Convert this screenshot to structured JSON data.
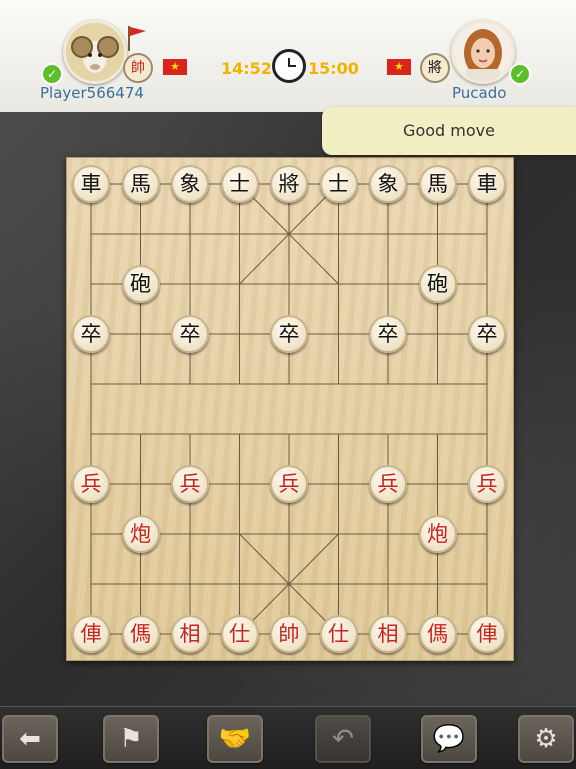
{
  "players": {
    "left": {
      "name": "Player566474",
      "piece": "帥",
      "time": "14:52"
    },
    "right": {
      "name": "Pucado",
      "piece": "將",
      "time": "15:00"
    }
  },
  "toast": {
    "message": "Good move"
  },
  "board": {
    "pieces": [
      {
        "char": "車",
        "side": "black",
        "file": 0,
        "rank": 0
      },
      {
        "char": "馬",
        "side": "black",
        "file": 1,
        "rank": 0
      },
      {
        "char": "象",
        "side": "black",
        "file": 2,
        "rank": 0
      },
      {
        "char": "士",
        "side": "black",
        "file": 3,
        "rank": 0
      },
      {
        "char": "將",
        "side": "black",
        "file": 4,
        "rank": 0
      },
      {
        "char": "士",
        "side": "black",
        "file": 5,
        "rank": 0
      },
      {
        "char": "象",
        "side": "black",
        "file": 6,
        "rank": 0
      },
      {
        "char": "馬",
        "side": "black",
        "file": 7,
        "rank": 0
      },
      {
        "char": "車",
        "side": "black",
        "file": 8,
        "rank": 0
      },
      {
        "char": "砲",
        "side": "black",
        "file": 1,
        "rank": 2
      },
      {
        "char": "砲",
        "side": "black",
        "file": 7,
        "rank": 2
      },
      {
        "char": "卒",
        "side": "black",
        "file": 0,
        "rank": 3
      },
      {
        "char": "卒",
        "side": "black",
        "file": 2,
        "rank": 3
      },
      {
        "char": "卒",
        "side": "black",
        "file": 4,
        "rank": 3
      },
      {
        "char": "卒",
        "side": "black",
        "file": 6,
        "rank": 3
      },
      {
        "char": "卒",
        "side": "black",
        "file": 8,
        "rank": 3
      },
      {
        "char": "兵",
        "side": "red",
        "file": 0,
        "rank": 6
      },
      {
        "char": "兵",
        "side": "red",
        "file": 2,
        "rank": 6
      },
      {
        "char": "兵",
        "side": "red",
        "file": 4,
        "rank": 6
      },
      {
        "char": "兵",
        "side": "red",
        "file": 6,
        "rank": 6
      },
      {
        "char": "兵",
        "side": "red",
        "file": 8,
        "rank": 6
      },
      {
        "char": "炮",
        "side": "red",
        "file": 1,
        "rank": 7
      },
      {
        "char": "炮",
        "side": "red",
        "file": 7,
        "rank": 7
      },
      {
        "char": "俥",
        "side": "red",
        "file": 0,
        "rank": 9
      },
      {
        "char": "傌",
        "side": "red",
        "file": 1,
        "rank": 9
      },
      {
        "char": "相",
        "side": "red",
        "file": 2,
        "rank": 9
      },
      {
        "char": "仕",
        "side": "red",
        "file": 3,
        "rank": 9
      },
      {
        "char": "帥",
        "side": "red",
        "file": 4,
        "rank": 9
      },
      {
        "char": "仕",
        "side": "red",
        "file": 5,
        "rank": 9
      },
      {
        "char": "相",
        "side": "red",
        "file": 6,
        "rank": 9
      },
      {
        "char": "傌",
        "side": "red",
        "file": 7,
        "rank": 9
      },
      {
        "char": "俥",
        "side": "red",
        "file": 8,
        "rank": 9
      }
    ]
  },
  "toolbar": {
    "buttons": [
      {
        "name": "back-button",
        "icon": "arrow-left-icon",
        "glyph": "⬅",
        "enabled": true
      },
      {
        "name": "resign-button",
        "icon": "white-flag-icon",
        "glyph": "⚑",
        "enabled": true
      },
      {
        "name": "offer-draw-button",
        "icon": "handshake-icon",
        "glyph": "🤝",
        "enabled": true
      },
      {
        "name": "undo-button",
        "icon": "undo-icon",
        "glyph": "↶",
        "enabled": false
      },
      {
        "name": "chat-button",
        "icon": "speech-bubble-icon",
        "glyph": "💬",
        "enabled": true
      },
      {
        "name": "settings-button",
        "icon": "gear-icon",
        "glyph": "⚙",
        "enabled": true
      }
    ]
  },
  "colors": {
    "red_piece": "#c8231f",
    "black_piece": "#111111",
    "timer": "#f0b400",
    "name": "#3b6f9a"
  }
}
